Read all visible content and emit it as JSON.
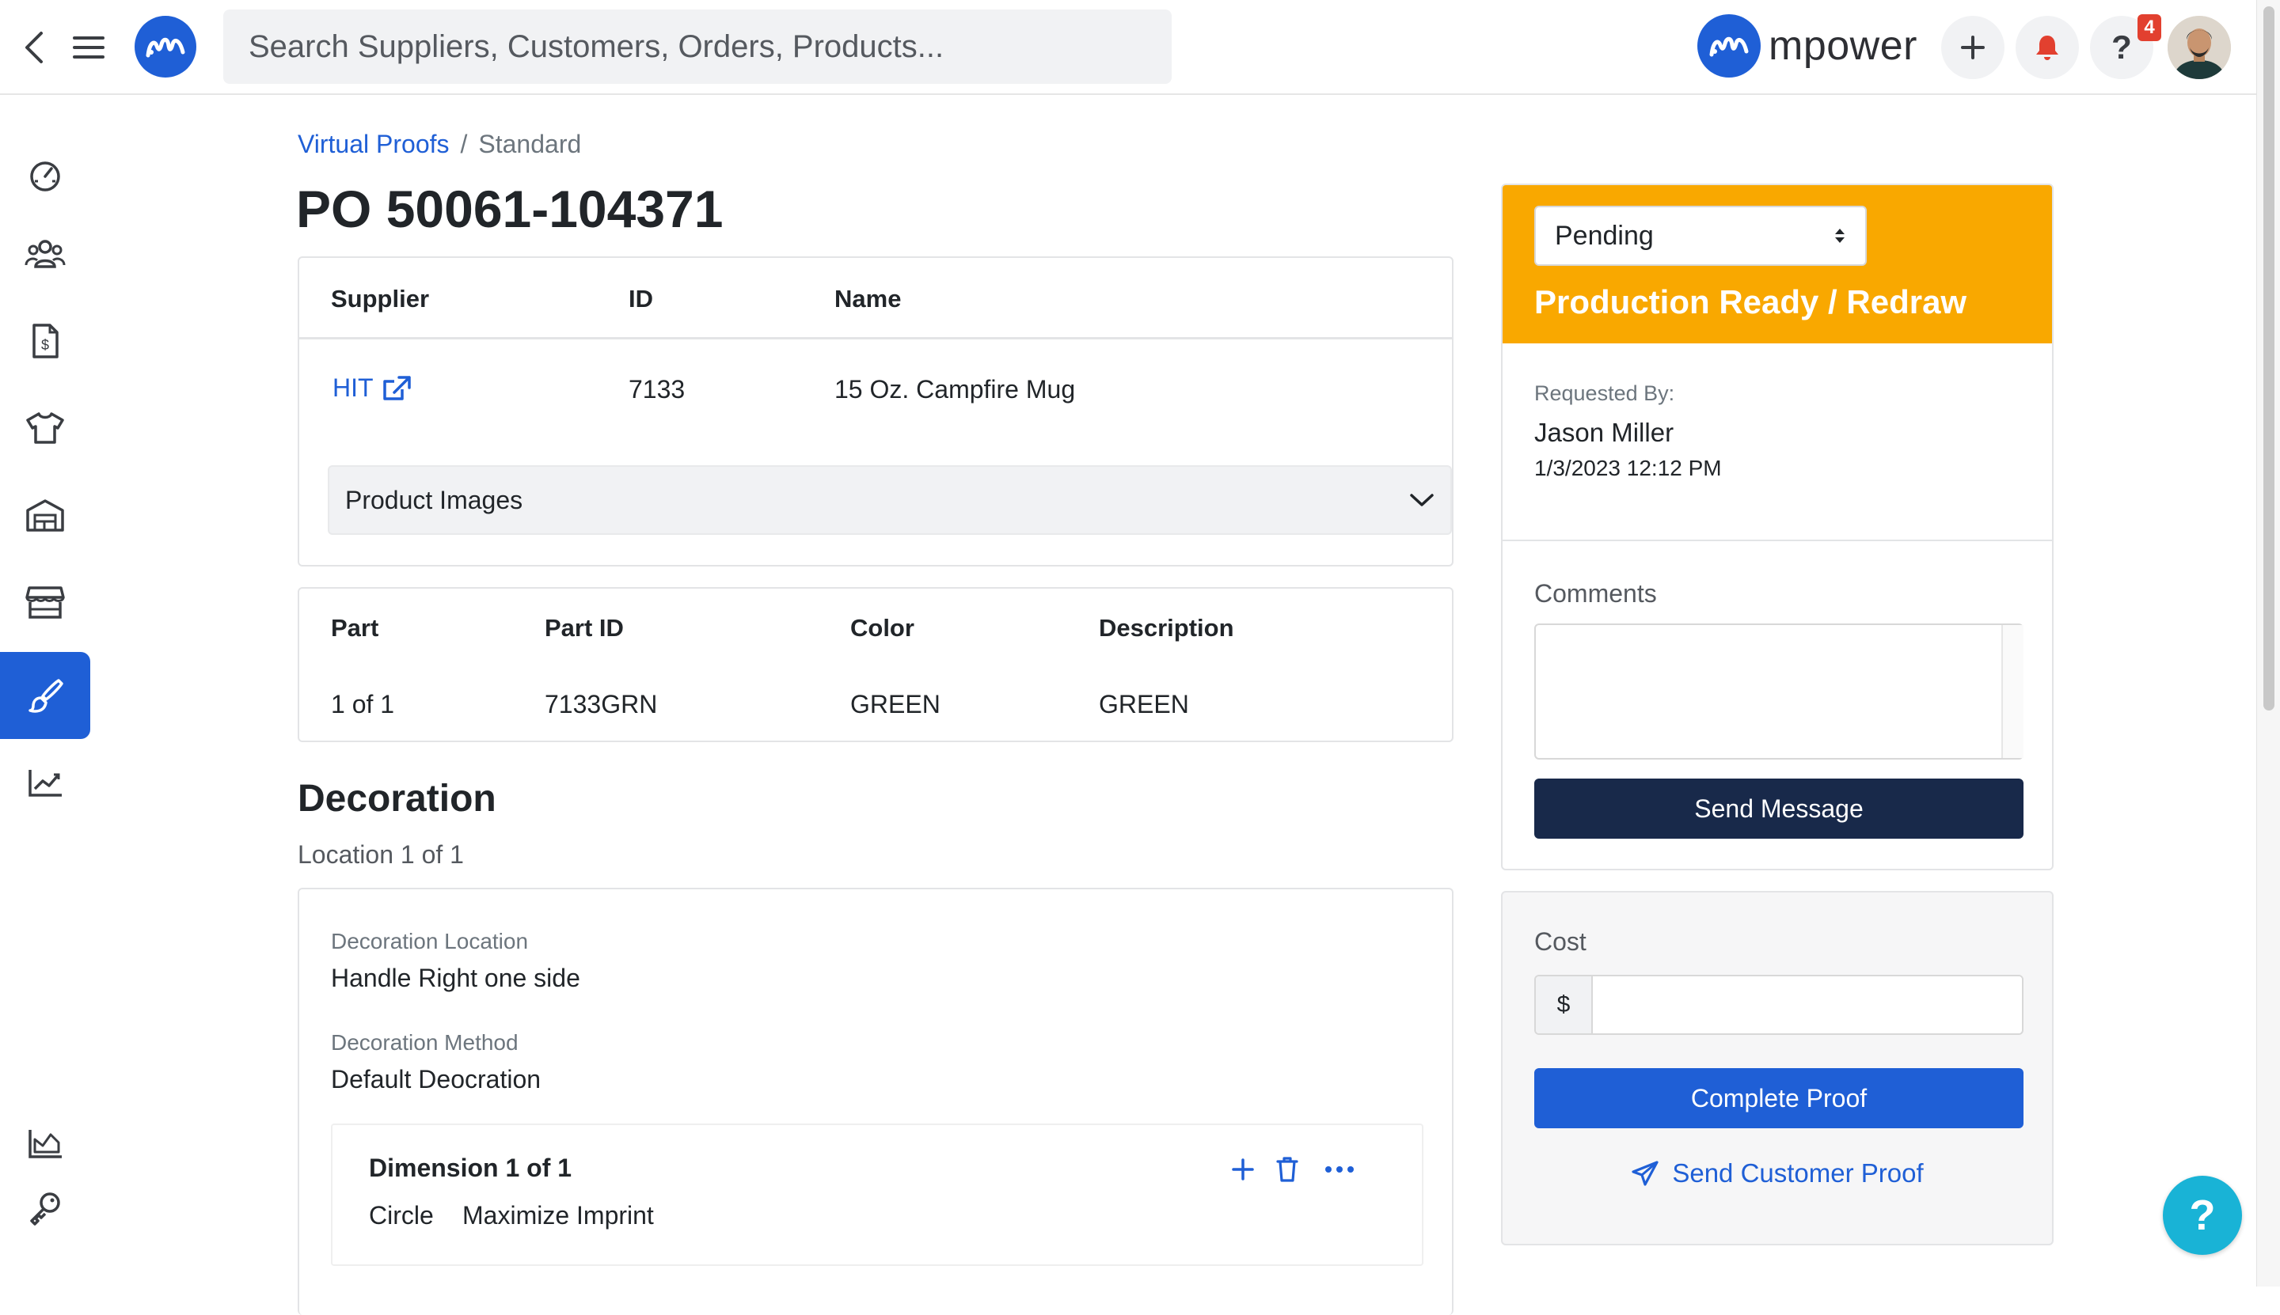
{
  "app": {
    "brand_name": "mpower"
  },
  "header": {
    "search_placeholder": "Search Suppliers, Customers, Orders, Products...",
    "notification_count": "4",
    "help_label": "?"
  },
  "sidebar": {
    "items": [
      {
        "name": "dashboard",
        "icon": "gauge-icon",
        "active": false
      },
      {
        "name": "customers",
        "icon": "users-icon",
        "active": false
      },
      {
        "name": "invoices",
        "icon": "invoice-icon",
        "active": false
      },
      {
        "name": "products",
        "icon": "tshirt-icon",
        "active": false
      },
      {
        "name": "warehouse",
        "icon": "warehouse-icon",
        "active": false
      },
      {
        "name": "store",
        "icon": "store-icon",
        "active": false
      },
      {
        "name": "virtual-proofs",
        "icon": "brush-icon",
        "active": true
      },
      {
        "name": "reports",
        "icon": "chart-line-icon",
        "active": false
      },
      {
        "name": "analytics",
        "icon": "chart-area-icon",
        "active": false
      },
      {
        "name": "settings",
        "icon": "key-icon",
        "active": false
      }
    ]
  },
  "breadcrumb": {
    "parent": "Virtual Proofs",
    "separator": "/",
    "current": "Standard"
  },
  "page": {
    "title": "PO 50061-104371"
  },
  "supplier_table": {
    "headers": {
      "supplier": "Supplier",
      "id": "ID",
      "name": "Name"
    },
    "row": {
      "supplier": "HIT",
      "id": "7133",
      "name": "15 Oz. Campfire Mug"
    },
    "accordion_label": "Product Images"
  },
  "parts_table": {
    "headers": {
      "part": "Part",
      "part_id": "Part ID",
      "color": "Color",
      "description": "Description"
    },
    "row": {
      "part": "1 of 1",
      "part_id": "7133GRN",
      "color": "GREEN",
      "description": "GREEN"
    }
  },
  "decoration": {
    "title": "Decoration",
    "location_count": "Location 1 of 1",
    "location_label": "Decoration Location",
    "location_value": "Handle Right one side",
    "method_label": "Decoration Method",
    "method_value": "Default Deocration",
    "dimension": {
      "title": "Dimension 1 of 1",
      "shape": "Circle",
      "mode": "Maximize Imprint"
    }
  },
  "status_panel": {
    "select_value": "Pending",
    "status_label": "Production Ready / Redraw",
    "status_color": "#f9a800",
    "requested_by_label": "Requested By:",
    "requested_by_name": "Jason Miller",
    "requested_date": "1/3/2023 12:12 PM",
    "comments_label": "Comments",
    "comments_value": "",
    "send_message_label": "Send Message"
  },
  "cost_panel": {
    "cost_label": "Cost",
    "currency_symbol": "$",
    "cost_value": "",
    "complete_label": "Complete Proof",
    "send_proof_label": "Send Customer Proof"
  },
  "help_fab": {
    "label": "?"
  },
  "colors": {
    "primary": "#1f5fd6",
    "navy": "#18294a",
    "accent": "#f9a800",
    "help": "#19b3d6"
  }
}
